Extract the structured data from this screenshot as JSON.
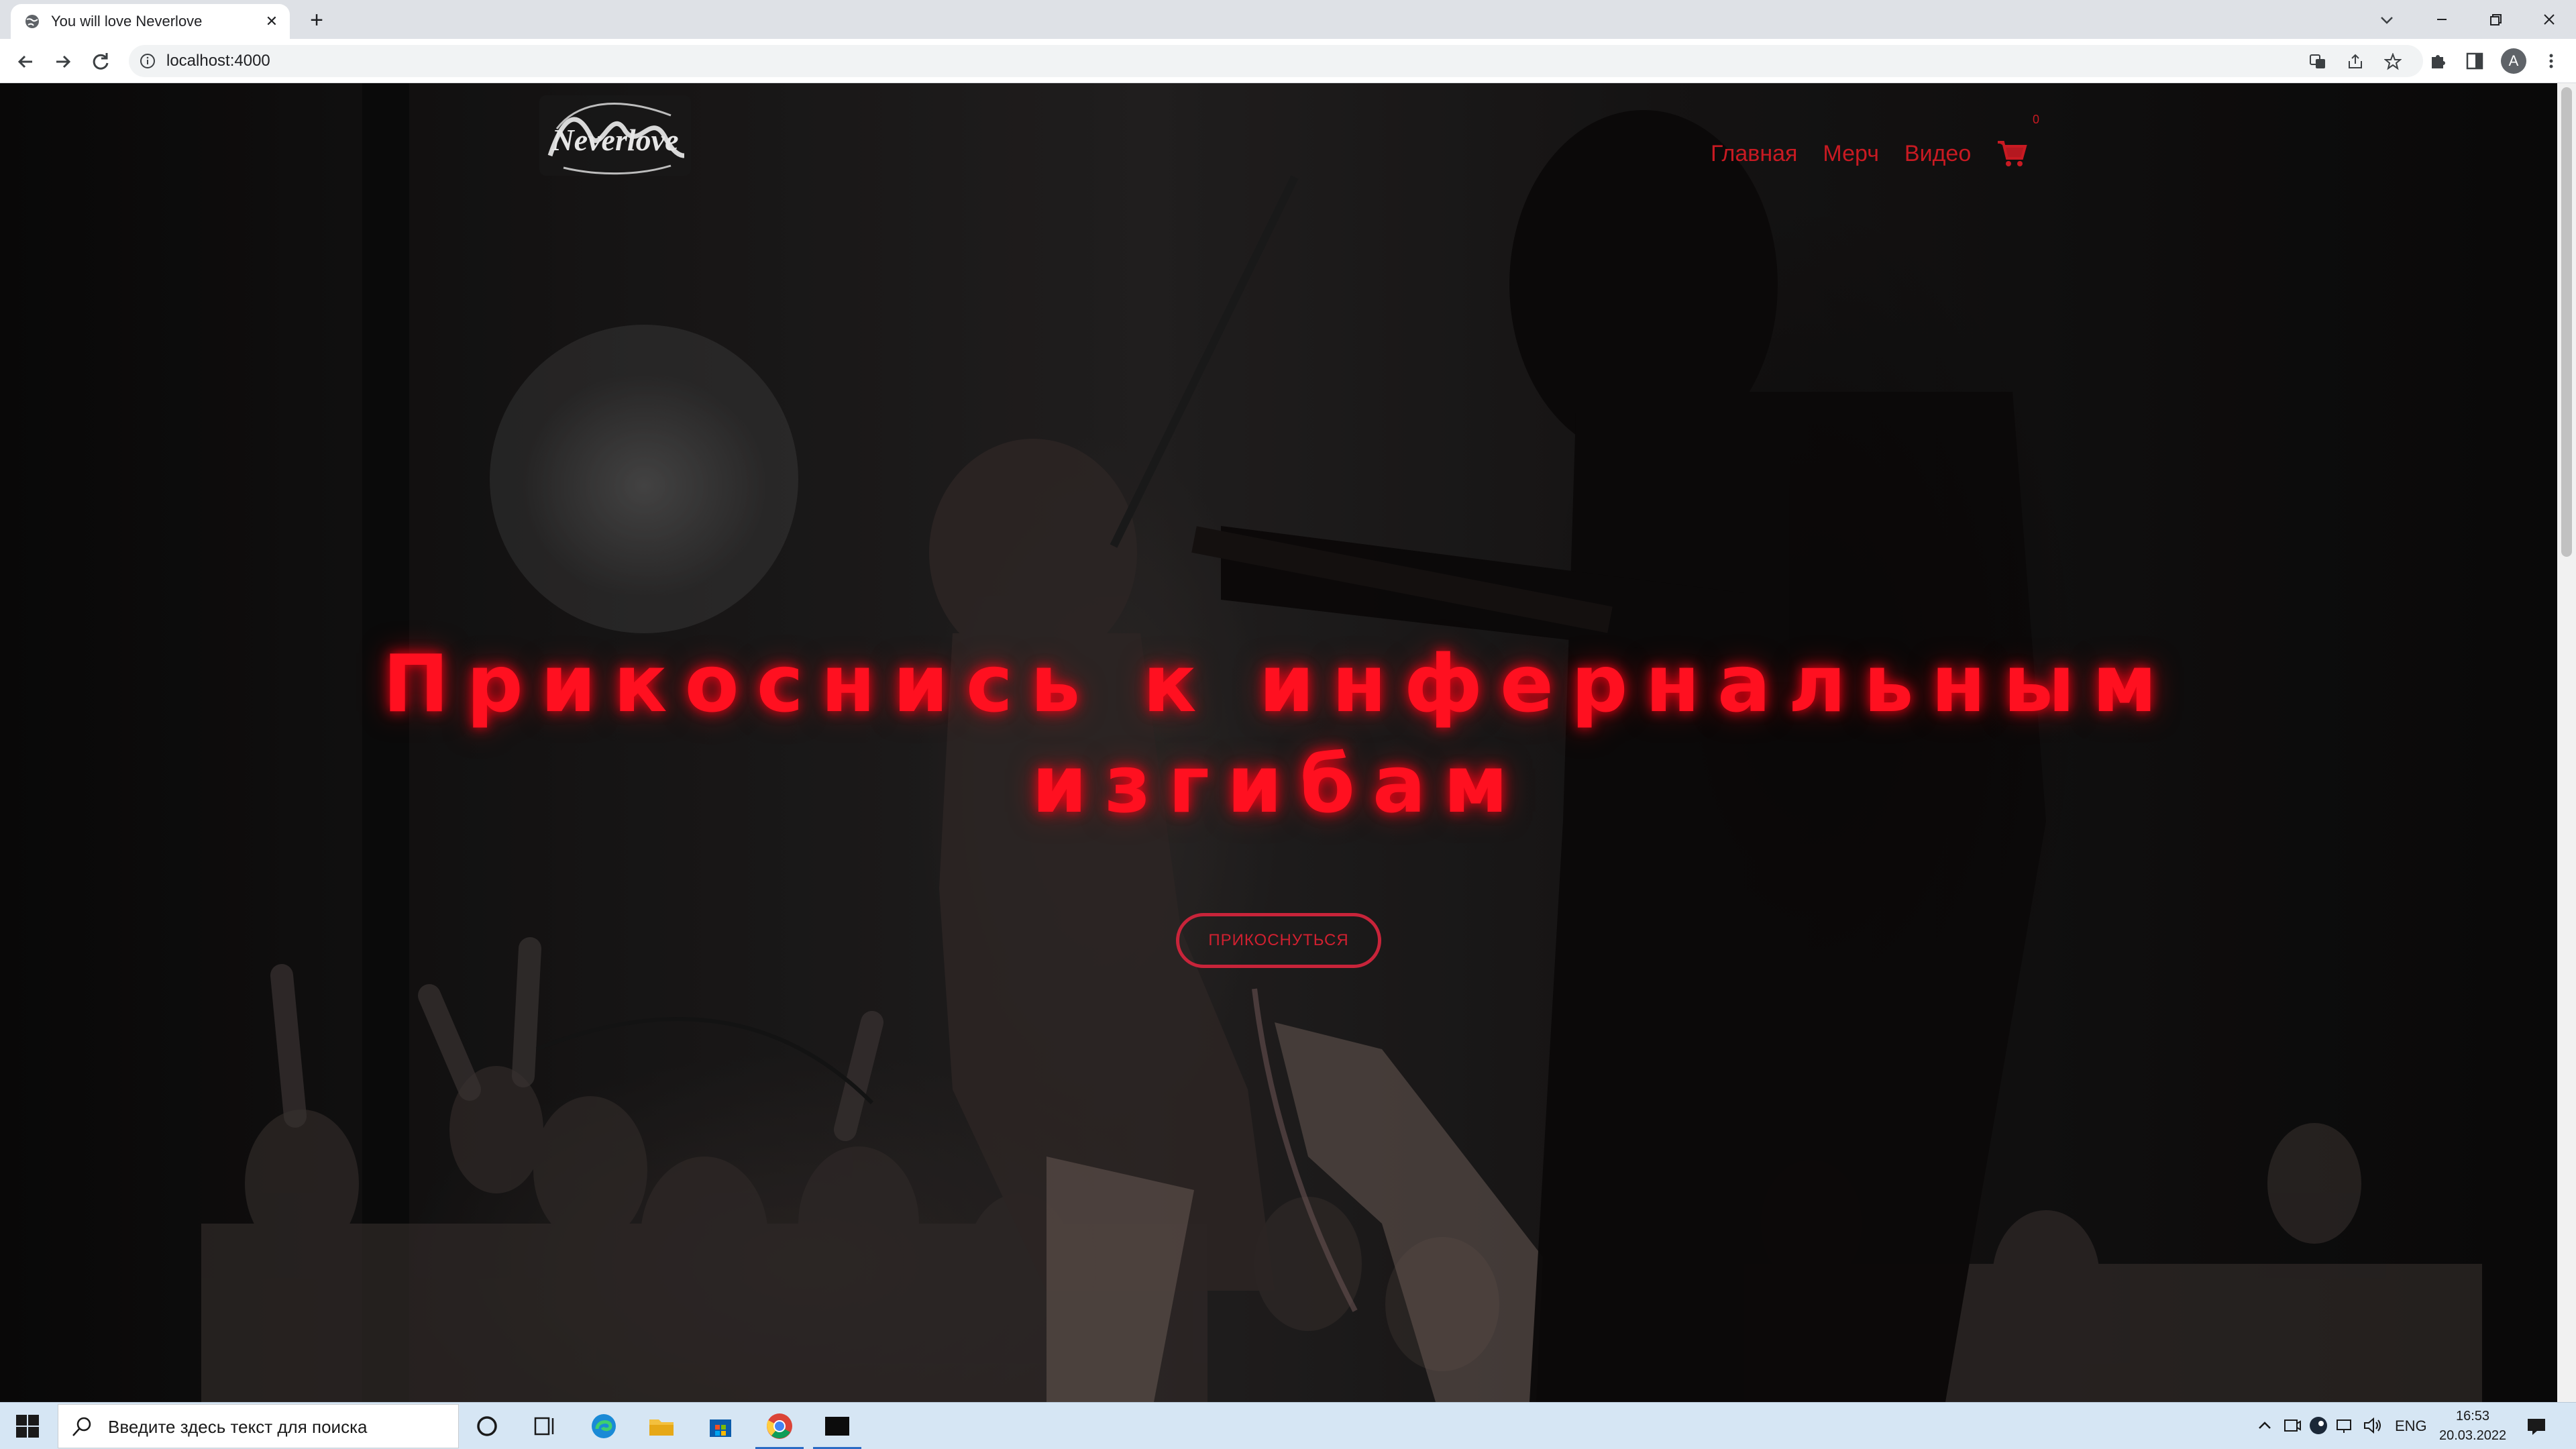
{
  "browser": {
    "tab_title": "You will love Neverlove",
    "url": "localhost:4000",
    "profile_initial": "A"
  },
  "site": {
    "logo_text": "Neverlove",
    "nav": [
      "Главная",
      "Мерч",
      "Видео"
    ],
    "cart_count": "0",
    "hero_title_line1": "Прикоснись к инфернальным",
    "hero_title_line2": "изгибам",
    "cta_label": "ПРИКОСНУТЬСЯ",
    "accent_color": "#ff1020"
  },
  "taskbar": {
    "search_placeholder": "Введите здесь текст для поиска",
    "language": "ENG",
    "time": "16:53",
    "date": "20.03.2022"
  }
}
